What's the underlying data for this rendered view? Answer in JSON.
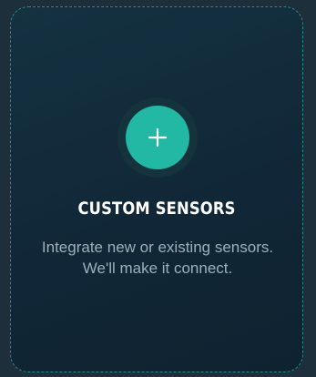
{
  "card": {
    "title": "CUSTOM SENSORS",
    "description": "Integrate new or existing sensors. We'll make it connect.",
    "icon": "plus-icon",
    "accent_color": "#22b8a3"
  }
}
